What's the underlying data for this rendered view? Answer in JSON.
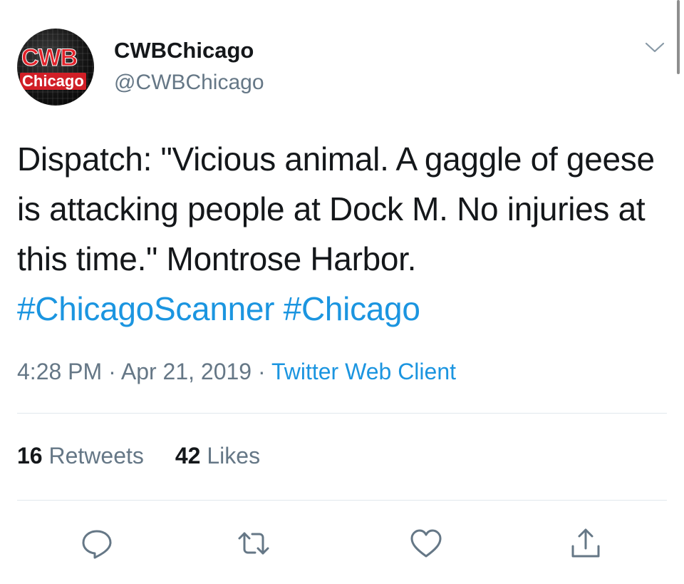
{
  "author": {
    "avatar_text_top": "CWB",
    "avatar_text_bottom": "Chicago",
    "display_name": "CWBChicago",
    "handle": "@CWBChicago"
  },
  "tweet": {
    "text_before": "Dispatch: \"Vicious animal. A gaggle of geese is attacking people at Dock M. No injuries at this time.\" Montrose Harbor. ",
    "hashtags": [
      "#ChicagoScanner",
      "#Chicago"
    ]
  },
  "meta": {
    "time": "4:28 PM",
    "separator": " · ",
    "date": "Apr 21, 2019",
    "client": "Twitter Web Client"
  },
  "stats": {
    "retweets_count": "16",
    "retweets_label": "Retweets",
    "likes_count": "42",
    "likes_label": "Likes"
  },
  "actions": {
    "icons": [
      "reply-icon",
      "retweet-icon",
      "like-icon",
      "share-icon"
    ]
  },
  "colors": {
    "link": "#1b95e0",
    "secondary_text": "#657786",
    "primary_text": "#14171a",
    "divider": "#e1e8ed",
    "avatar_red": "#e3222a"
  }
}
